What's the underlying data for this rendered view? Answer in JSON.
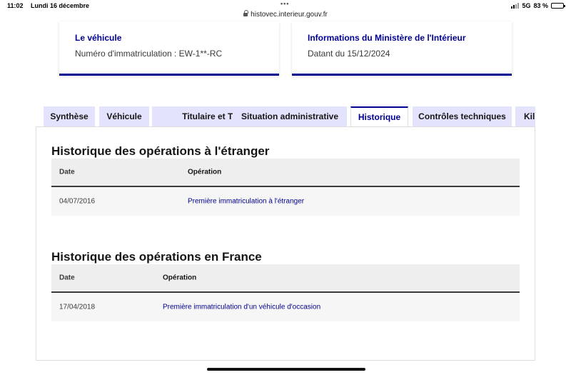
{
  "status_bar": {
    "time": "11:02",
    "date": "Lundi 16 décembre",
    "dots": "•••",
    "network": "5G",
    "battery": "83 %",
    "battery_level": 0.83
  },
  "browser": {
    "url": "histovec.interieur.gouv.fr"
  },
  "cards": {
    "vehicle": {
      "title": "Le véhicule",
      "desc": "Numéro d'immatriculation : EW-1**-RC"
    },
    "ministry": {
      "title": "Informations du Ministère de l'Intérieur",
      "desc": "Datant du 15/12/2024"
    }
  },
  "tabs": [
    {
      "label": "Synthèse"
    },
    {
      "label": "Véhicule"
    },
    {
      "label": "Titulaire et Titre"
    },
    {
      "label": "Situation administrative"
    },
    {
      "label": "Historique",
      "active": true
    },
    {
      "label": "Contrôles techniques"
    },
    {
      "label": "Kil"
    }
  ],
  "sections": {
    "abroad": {
      "title": "Historique des opérations à l'étranger",
      "columns": [
        "Date",
        "Opération"
      ],
      "rows": [
        {
          "date": "04/07/2016",
          "operation": "Première immatriculation à l'étranger"
        }
      ]
    },
    "france": {
      "title": "Historique des opérations en France",
      "columns": [
        "Date",
        "Opération"
      ],
      "rows": [
        {
          "date": "17/04/2018",
          "operation": "Première immatriculation d'un véhicule d'occasion"
        }
      ]
    }
  },
  "colors": {
    "accent": "#000091",
    "tab_bg": "#e3e3fd",
    "table_header_bg": "#eeeeee",
    "table_row_bg": "#f6f6f6"
  }
}
